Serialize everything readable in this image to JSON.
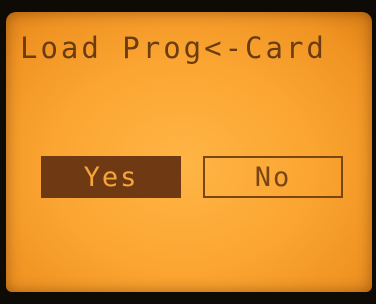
{
  "screen": {
    "title": "Load Prog<-Card"
  },
  "buttons": {
    "yes_label": "Yes",
    "no_label": "No",
    "selected": "Yes"
  },
  "colors": {
    "backlight": "#fba532",
    "text": "#6a3c10",
    "selected_fill": "#6f3a13"
  }
}
